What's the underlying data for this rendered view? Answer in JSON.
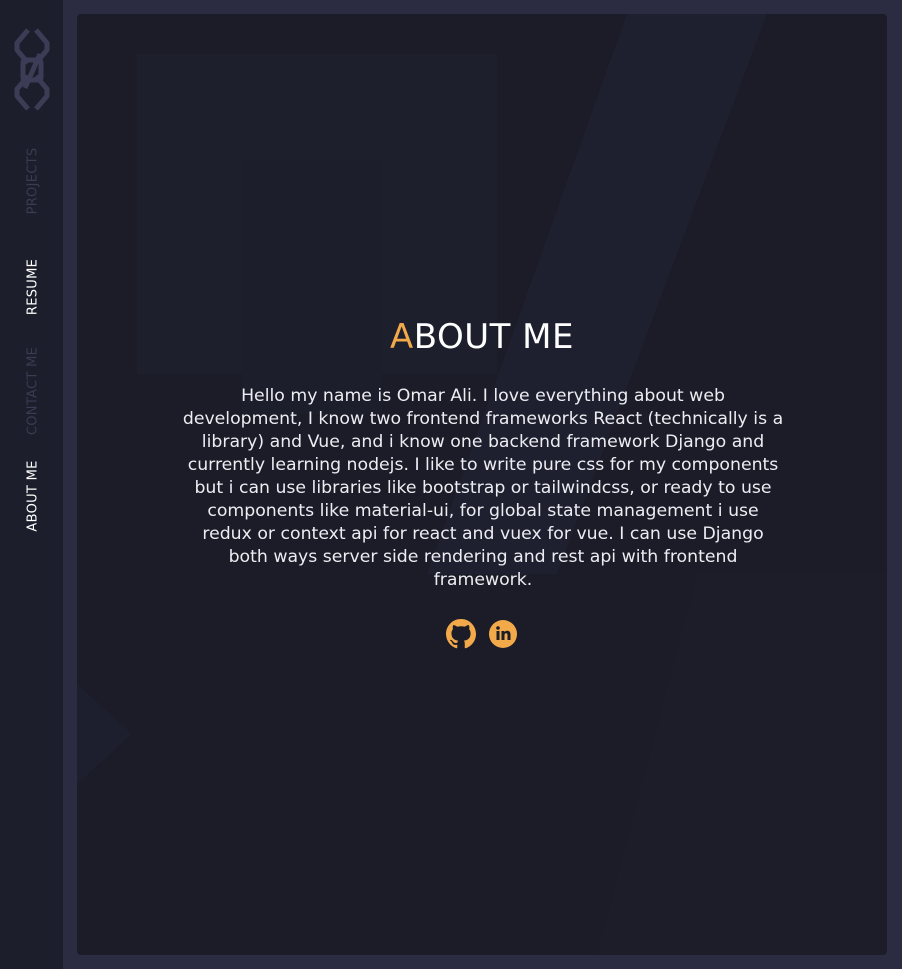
{
  "nav": {
    "logo_icon": "code-brackets-logo-icon",
    "items": [
      {
        "label": "PROJECTS",
        "active": false
      },
      {
        "label": "RESUME",
        "active": true
      },
      {
        "label": "CONTACT ME",
        "active": false
      },
      {
        "label": "ABOUT ME",
        "active": true
      }
    ]
  },
  "about": {
    "title_first_letter": "A",
    "title_rest": "BOUT ME",
    "bio": "Hello my name is Omar Ali. I love everything about web development, I know two frontend frameworks React (technically is a library) and Vue, and i know one backend framework Django and currently learning nodejs. I like to write pure css for my components but i can use libraries like bootstrap or tailwindcss, or ready to use components like material-ui, for global state management i use redux or context api for react and vuex for vue. I can use Django both ways server side rendering and rest api with frontend framework."
  },
  "social": {
    "github_icon": "github-icon",
    "linkedin_icon": "linkedin-icon"
  },
  "colors": {
    "accent": "#f2a94a",
    "sidebar_bg": "#1c1e2b",
    "panel_bg": "#1b1c28",
    "page_bg": "#2b2c42",
    "nav_dim": "#393c52",
    "text": "#ffffff"
  }
}
